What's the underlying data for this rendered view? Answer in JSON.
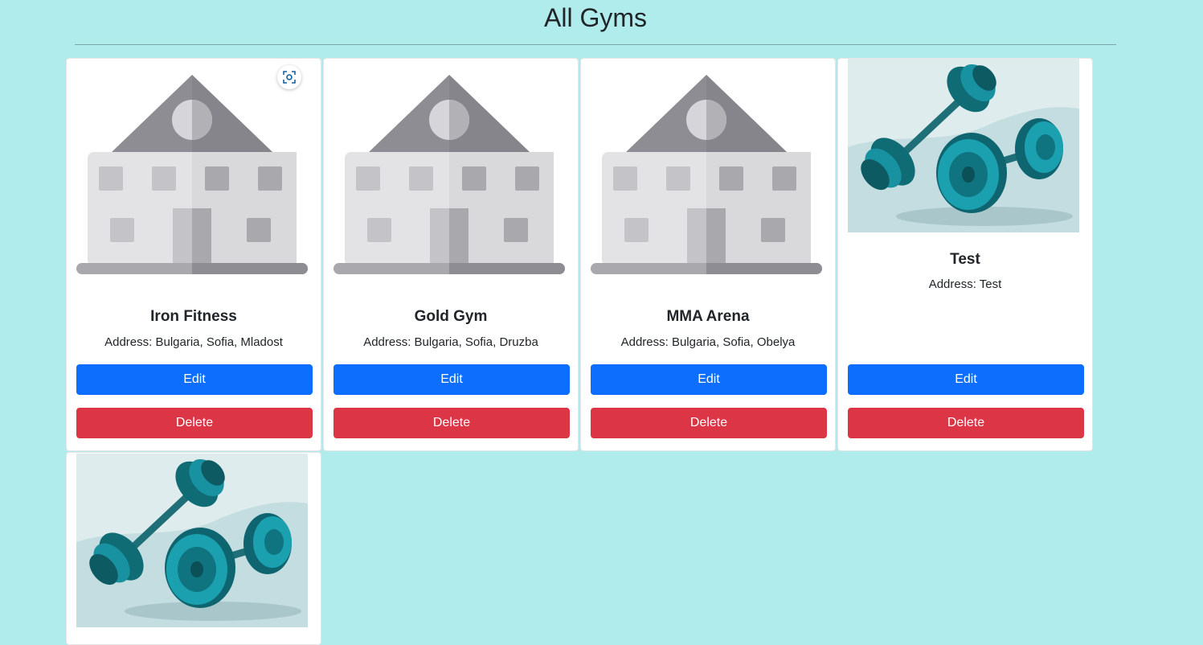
{
  "page": {
    "title": "All Gyms"
  },
  "gyms": [
    {
      "name": "Iron Fitness",
      "address": "Address: Bulgaria, Sofia, Mladost",
      "image_icon": "building-icon",
      "edit_label": "Edit",
      "delete_label": "Delete"
    },
    {
      "name": "Gold Gym",
      "address": "Address: Bulgaria, Sofia, Druzba",
      "image_icon": "building-icon",
      "edit_label": "Edit",
      "delete_label": "Delete"
    },
    {
      "name": "MMA Arena",
      "address": "Address: Bulgaria, Sofia, Obelya",
      "image_icon": "building-icon",
      "edit_label": "Edit",
      "delete_label": "Delete"
    },
    {
      "name": "Test",
      "address": "Address: Test",
      "image_icon": "dumbbells-photo",
      "edit_label": "Edit",
      "delete_label": "Delete"
    },
    {
      "name": "",
      "address": "",
      "image_icon": "dumbbells-photo"
    }
  ],
  "overlay": {
    "icon": "visual-search-icon"
  },
  "colors": {
    "background": "#b0ecec",
    "edit_button": "#0d6efd",
    "delete_button": "#dc3545",
    "card": "#ffffff"
  }
}
